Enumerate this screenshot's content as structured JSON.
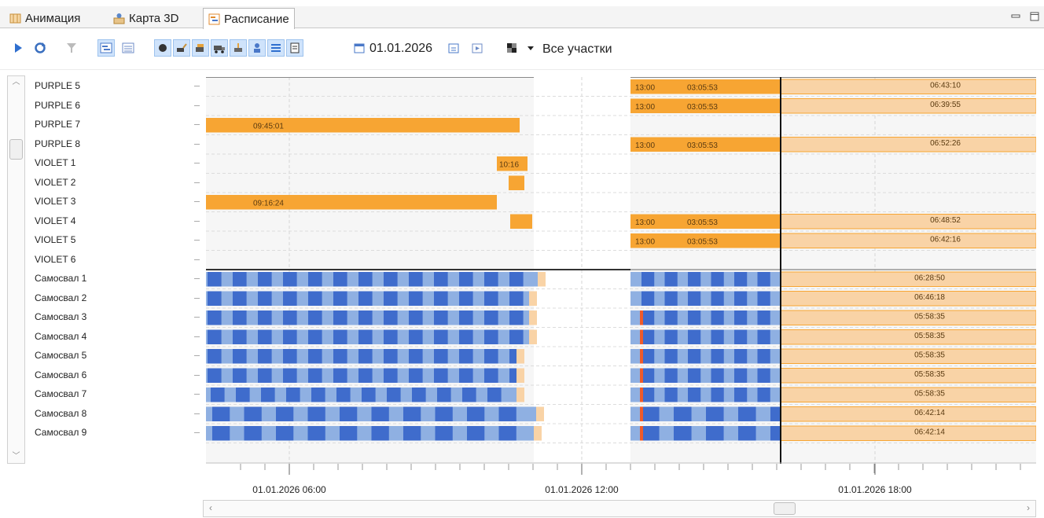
{
  "tabs": [
    {
      "label": "Анимация",
      "icon": "map-icon",
      "active": false
    },
    {
      "label": "Карта 3D",
      "icon": "person-map-icon",
      "active": false
    },
    {
      "label": "Расписание",
      "icon": "schedule-icon",
      "active": true
    }
  ],
  "toolbar": {
    "date": "01.01.2026",
    "area_filter": "Все участки"
  },
  "rows": [
    "PURPLE 5",
    "PURPLE 6",
    "PURPLE 7",
    "PURPLE 8",
    "VIOLET 1",
    "VIOLET 2",
    "VIOLET 3",
    "VIOLET 4",
    "VIOLET 5",
    "VIOLET 6",
    "Самосвал 1",
    "Самосвал 2",
    "Самосвал 3",
    "Самосвал 4",
    "Самосвал 5",
    "Самосвал 6",
    "Самосвал 7",
    "Самосвал 8",
    "Самосвал 9"
  ],
  "axis": {
    "ticks": [
      "01.01.2026 06:00",
      "01.01.2026 12:00",
      "01.01.2026 18:00"
    ]
  },
  "colors": {
    "task": "#f7a533",
    "task_light": "#f9d3a6",
    "haul_dark": "#3f6ccc",
    "haul_light": "#8fb0e2",
    "accent_red": "#ee5a2b"
  },
  "excavator_rows": [
    {
      "left_bar": null,
      "right": {
        "a": "13:00",
        "b": "03:05:53",
        "c": "06:43:10"
      }
    },
    {
      "left_bar": null,
      "right": {
        "a": "13:00",
        "b": "03:05:53",
        "c": "06:39:55"
      }
    },
    {
      "left_bar": {
        "label": "09:45:01"
      },
      "right": null
    },
    {
      "left_bar": null,
      "right": {
        "a": "13:00",
        "b": "03:05:53",
        "c": "06:52:26"
      }
    },
    {
      "left_bar": {
        "label": "10:16"
      },
      "right": null
    },
    {
      "left_bar": {
        "label": ""
      },
      "right": null
    },
    {
      "left_bar": {
        "label": "09:16:24"
      },
      "right": null
    },
    {
      "left_bar": {
        "label": ""
      },
      "right": {
        "a": "13:00",
        "b": "03:05:53",
        "c": "06:48:52"
      }
    },
    {
      "left_bar": null,
      "right": {
        "a": "13:00",
        "b": "03:05:53",
        "c": "06:42:16"
      }
    },
    {
      "left_bar": null,
      "right": null
    }
  ],
  "truck_rows": [
    {
      "label": "06:28:50"
    },
    {
      "label": "06:46:18"
    },
    {
      "label": "05:58:35"
    },
    {
      "label": "05:58:35"
    },
    {
      "label": "05:58:35"
    },
    {
      "label": "05:58:35"
    },
    {
      "label": "05:58:35"
    },
    {
      "label": "06:42:14"
    },
    {
      "label": "06:42:14"
    }
  ]
}
